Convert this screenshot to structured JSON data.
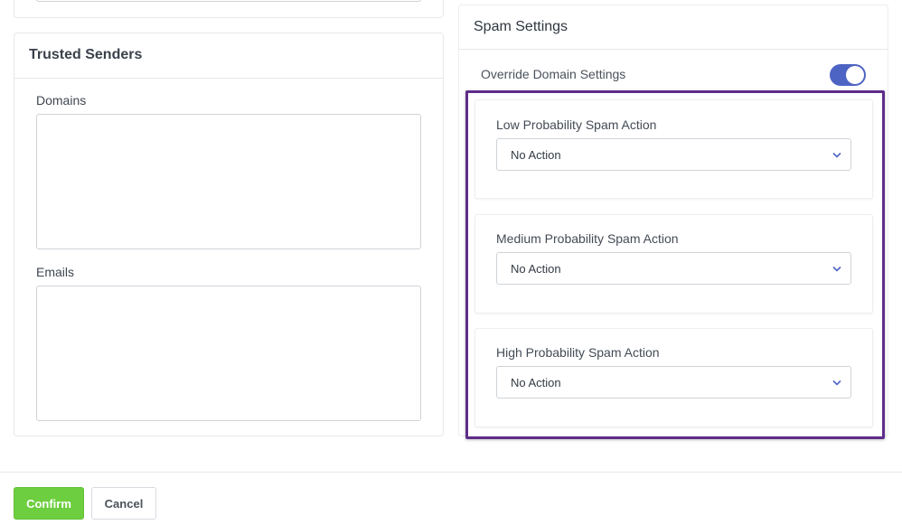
{
  "trusted_senders": {
    "title": "Trusted Senders",
    "domains_label": "Domains",
    "domains_value": "",
    "emails_label": "Emails",
    "emails_value": ""
  },
  "spam_settings": {
    "title": "Spam Settings",
    "override_label": "Override Domain Settings",
    "override_enabled": true,
    "actions": [
      {
        "label": "Low Probability Spam Action",
        "value": "No Action"
      },
      {
        "label": "Medium Probability Spam Action",
        "value": "No Action"
      },
      {
        "label": "High Probability Spam Action",
        "value": "No Action"
      }
    ]
  },
  "footer": {
    "confirm_label": "Confirm",
    "cancel_label": "Cancel"
  },
  "colors": {
    "toggle_on": "#4e64c4",
    "highlight_border": "#5e2d8a",
    "confirm_bg": "#6dce3f",
    "chevron": "#4e64c4"
  }
}
